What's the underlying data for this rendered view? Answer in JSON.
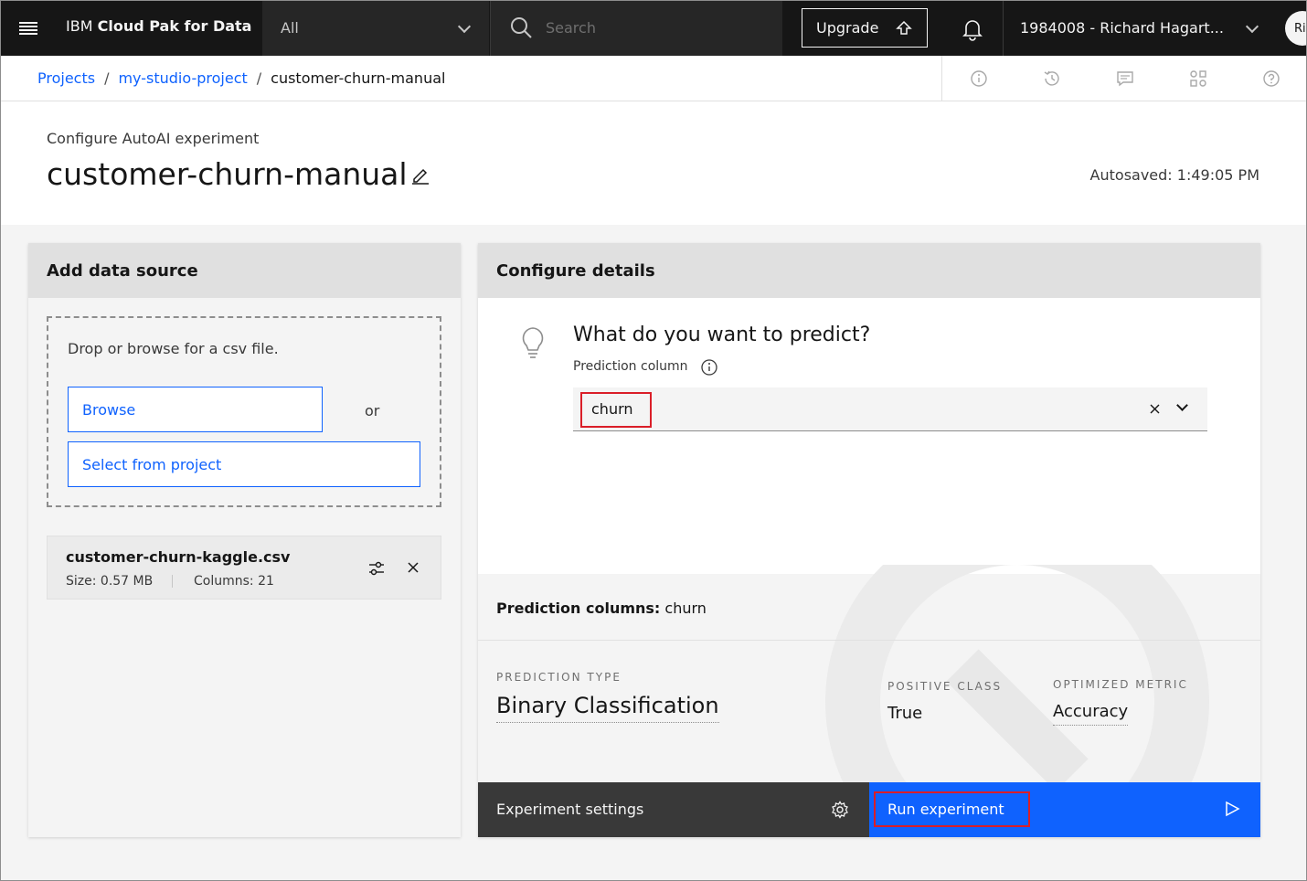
{
  "topbar": {
    "brand_prefix": "IBM ",
    "brand_name": "Cloud Pak for Data",
    "scope_label": "All",
    "search_placeholder": "Search",
    "upgrade_label": "Upgrade",
    "account_label": "1984008 - Richard Hagart...",
    "avatar_initials": "Ri"
  },
  "breadcrumb": {
    "items": [
      "Projects",
      "my-studio-project",
      "customer-churn-manual"
    ],
    "separator": "/"
  },
  "header": {
    "subtitle": "Configure AutoAI experiment",
    "title": "customer-churn-manual",
    "autosaved": "Autosaved: 1:49:05 PM"
  },
  "data_source": {
    "heading": "Add data source",
    "drop_text": "Drop or browse for a csv file.",
    "browse_label": "Browse",
    "or_label": "or",
    "select_project_label": "Select from project",
    "file": {
      "name": "customer-churn-kaggle.csv",
      "size": "Size: 0.57 MB",
      "columns": "Columns: 21"
    }
  },
  "configure": {
    "heading": "Configure details",
    "question": "What do you want to predict?",
    "prediction_column_label": "Prediction column",
    "prediction_value": "churn",
    "summary_label": "Prediction columns:",
    "summary_value": " churn",
    "prediction_type_label": "PREDICTION TYPE",
    "prediction_type_value": "Binary Classification",
    "positive_class_label": "POSITIVE CLASS",
    "positive_class_value": "True",
    "optimized_metric_label": "OPTIMIZED METRIC",
    "optimized_metric_value": "Accuracy",
    "settings_label": "Experiment settings",
    "run_label": "Run experiment"
  },
  "colors": {
    "accent": "#0f62fe",
    "topbar": "#161616",
    "highlight": "#da1e28"
  },
  "icons": [
    "menu-icon",
    "search-icon",
    "upgrade-arrow-icon",
    "notification-bell-icon",
    "info-icon",
    "history-icon",
    "comment-icon",
    "assets-icon",
    "help-icon",
    "edit-icon",
    "settings-adjust-icon",
    "close-icon",
    "lightbulb-icon",
    "gear-icon",
    "play-icon"
  ]
}
